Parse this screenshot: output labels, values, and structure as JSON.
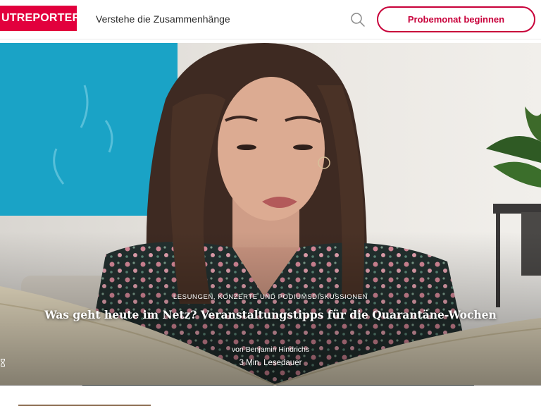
{
  "header": {
    "logo_text": "UTREPORTER",
    "tagline": "Verstehe die Zusammenhänge",
    "cta_label": "Probemonat beginnen",
    "search_icon": "search-icon",
    "brand_color": "#e2003d"
  },
  "article": {
    "category": "LESUNGEN, KONZERTE UND PODIUMSDISKUSSIONEN",
    "headline": "Was geht heute im Netz? Veranstaltungstipps für die Quarantäne-Wochen",
    "author": "von Benjamin Hindrichs",
    "reading_time": "3 Min. Lesedauer",
    "reading_icon": "hourglass-icon"
  }
}
